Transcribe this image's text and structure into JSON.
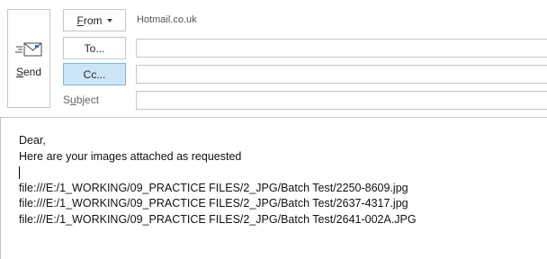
{
  "send": {
    "label_prefix": "",
    "label_underlined": "S",
    "label_rest": "end"
  },
  "from": {
    "label_underlined": "F",
    "label_rest": "rom",
    "address": "Hotmail.co.uk"
  },
  "to": {
    "label": "To...",
    "value": ""
  },
  "cc": {
    "label": "Cc...",
    "value": ""
  },
  "subject": {
    "label_prefix": "S",
    "label_underlined": "u",
    "label_rest": "bject",
    "value": ""
  },
  "body": {
    "greeting": "Dear,",
    "line1": "Here are your images attached as requested",
    "links": [
      "file:///E:/1_WORKING/09_PRACTICE FILES/2_JPG/Batch Test/2250-8609.jpg",
      "file:///E:/1_WORKING/09_PRACTICE FILES/2_JPG/Batch Test/2637-4317.jpg",
      "file:///E:/1_WORKING/09_PRACTICE FILES/2_JPG/Batch Test/2641-002A.JPG"
    ]
  },
  "colors": {
    "border": "#c6c6c6",
    "cc_active_bg": "#cde6f7",
    "cc_active_border": "#79b8e6"
  },
  "icons": {
    "send": "envelope-send-icon",
    "from_dropdown": "chevron-down-icon"
  }
}
